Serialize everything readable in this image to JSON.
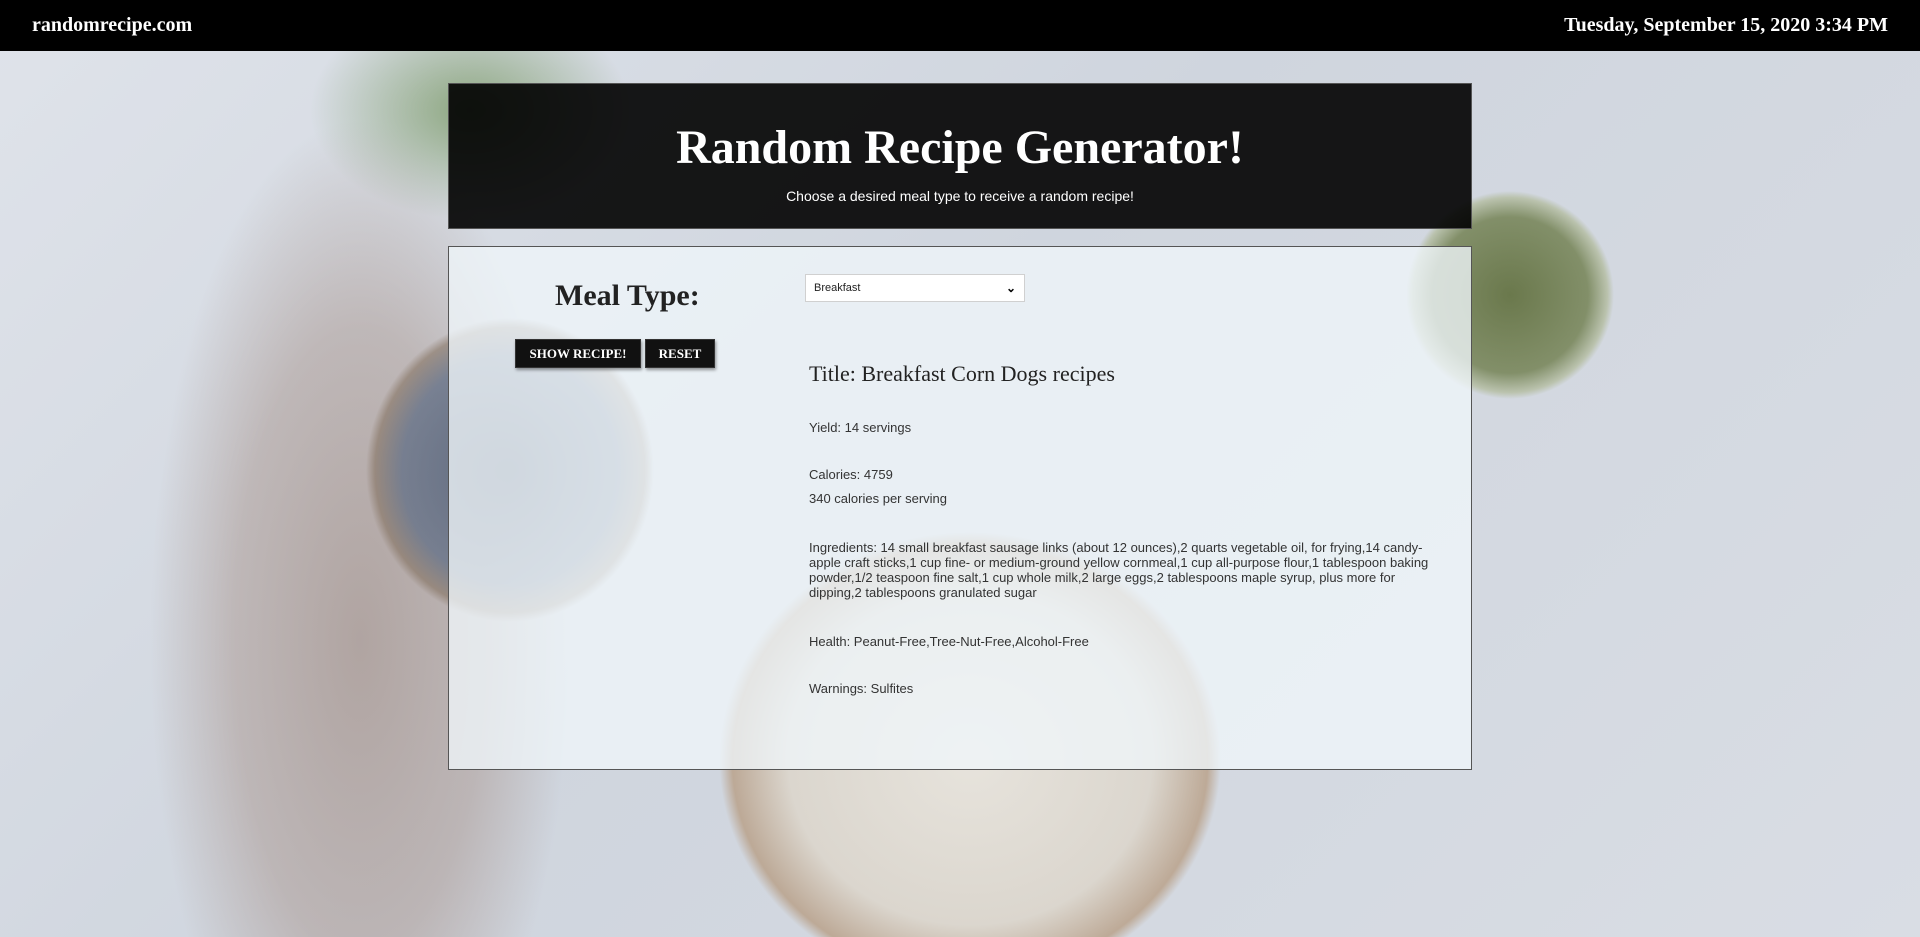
{
  "topbar": {
    "site": "randomrecipe.com",
    "datetime": "Tuesday, September 15, 2020 3:34 PM"
  },
  "header": {
    "title": "Random Recipe Generator!",
    "subtitle": "Choose a desired meal type to receive a random recipe!"
  },
  "form": {
    "meal_type_label": "Meal Type:",
    "meal_type_selected": "Breakfast",
    "show_button": "SHOW RECIPE!",
    "reset_button": "RESET"
  },
  "recipe": {
    "title": "Title: Breakfast Corn Dogs recipes",
    "yield": "Yield: 14 servings",
    "calories": "Calories: 4759",
    "per_serving": "340 calories per serving",
    "ingredients": "Ingredients: 14 small breakfast sausage links (about 12 ounces),2 quarts vegetable oil, for frying,14 candy-apple craft sticks,1 cup fine- or medium-ground yellow cornmeal,1 cup all-purpose flour,1 tablespoon baking powder,1/2 teaspoon fine salt,1 cup whole milk,2 large eggs,2 tablespoons maple syrup, plus more for dipping,2 tablespoons granulated sugar",
    "health": "Health: Peanut-Free,Tree-Nut-Free,Alcohol-Free",
    "warnings": "Warnings: Sulfites"
  },
  "icons": {
    "select": "chevron-down-icon"
  }
}
